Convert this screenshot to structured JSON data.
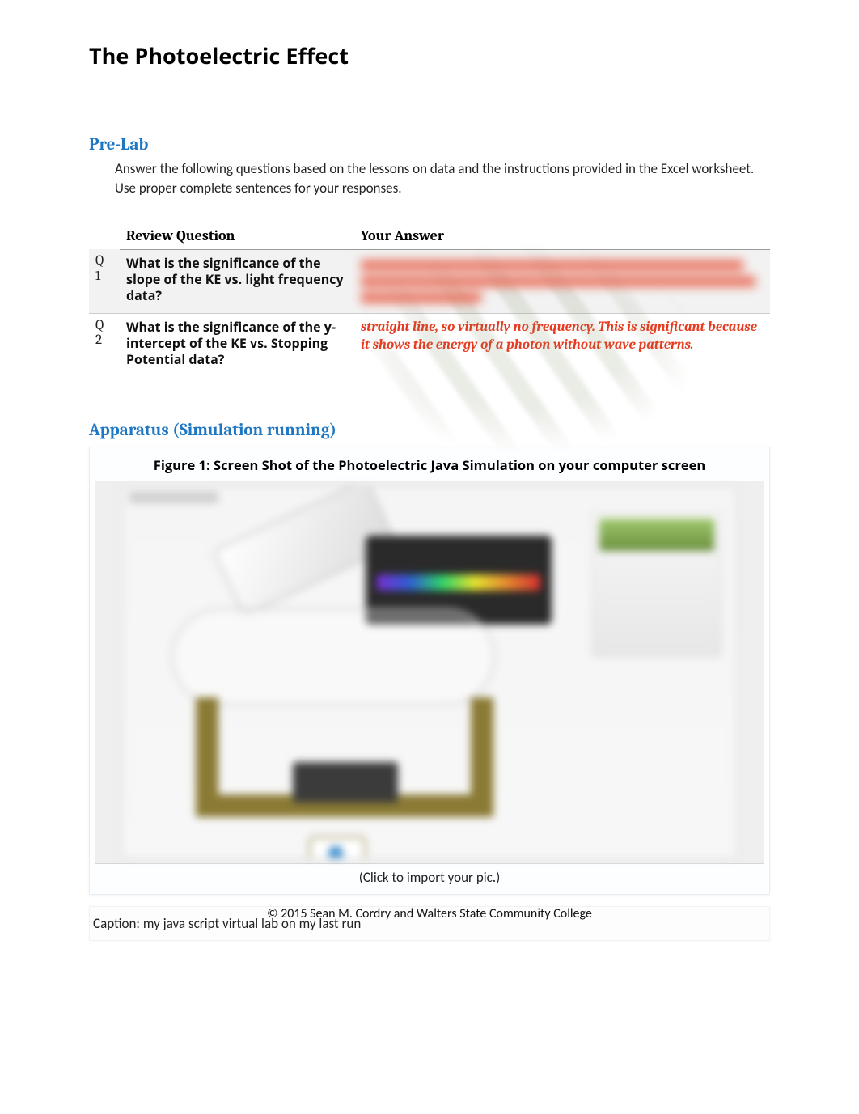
{
  "title": "The Photoelectric Effect",
  "prelab": {
    "heading": "Pre-Lab",
    "intro": "Answer the following questions based on the lessons on data and the instructions provided in the Excel worksheet. Use proper complete sentences for your responses.",
    "headers": {
      "question": "Review Question",
      "answer": "Your Answer"
    },
    "rows": [
      {
        "num": "Q1",
        "question": "What is the significance of the slope of the KE vs. light frequency data?",
        "answer_redacted": true
      },
      {
        "num": "Q2",
        "question": "What is the significance of the y-intercept of the KE vs. Stopping Potential data?",
        "answer": "straight line, so virtually no frequency. This is significant because it shows the energy of a photon without wave patterns."
      }
    ]
  },
  "apparatus": {
    "heading": "Apparatus (Simulation running)",
    "figure_title": "Figure 1: Screen Shot of the Photoelectric Java Simulation on your computer screen",
    "click_hint": "(Click to import your pic.)",
    "caption_prefix": "Caption: ",
    "caption_text": "my java script virtual lab on my last run"
  },
  "footer": "© 2015 Sean M. Cordry and Walters State Community College"
}
